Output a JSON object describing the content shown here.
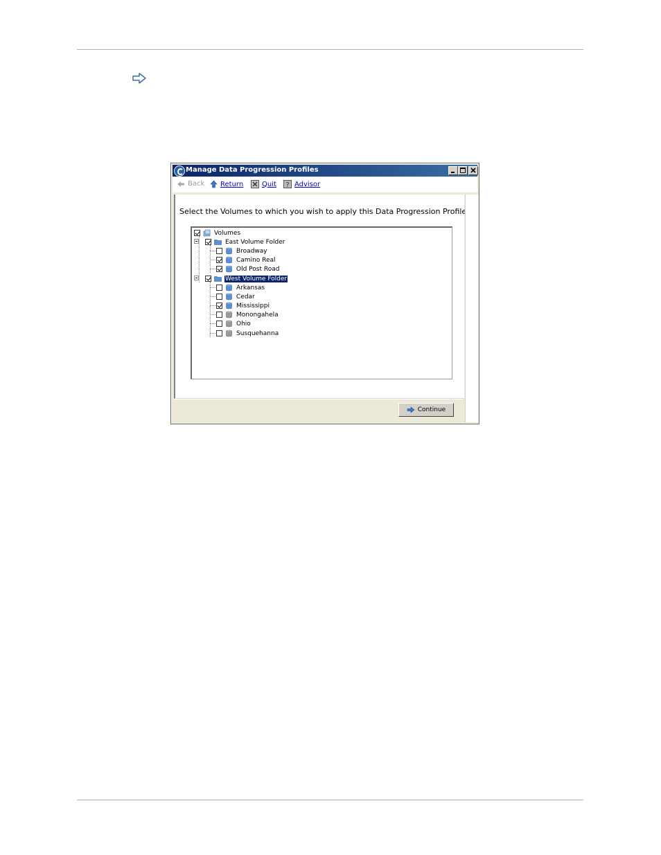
{
  "window": {
    "title": "Manage Data Progression Profiles"
  },
  "toolbar": {
    "back_label": "Back",
    "return_label": "Return",
    "quit_label": "Quit",
    "advisor_label": "Advisor"
  },
  "prompt": "Select the Volumes to which you wish to apply this Data Progression Profile:",
  "tree": {
    "root": {
      "label": "Volumes",
      "checked": true
    },
    "folders": [
      {
        "label": "East Volume Folder",
        "checked": true,
        "selected": false,
        "items": [
          {
            "label": "Broadway",
            "checked": false
          },
          {
            "label": "Camino Real",
            "checked": true
          },
          {
            "label": "Old Post Road",
            "checked": true
          }
        ]
      },
      {
        "label": "West Volume Folder",
        "checked": true,
        "selected": true,
        "items": [
          {
            "label": "Arkansas",
            "checked": false
          },
          {
            "label": "Cedar",
            "checked": false
          },
          {
            "label": "Mississippi",
            "checked": true
          },
          {
            "label": "Monongahela",
            "checked": false
          },
          {
            "label": "Ohio",
            "checked": false
          },
          {
            "label": "Susquehanna",
            "checked": false
          }
        ]
      }
    ]
  },
  "footer": {
    "continue_label": "Continue"
  },
  "colors": {
    "titlebar": "#0a246a",
    "link": "#0000cc",
    "selection": "#0a246a",
    "rule": "#9fb6c9"
  }
}
